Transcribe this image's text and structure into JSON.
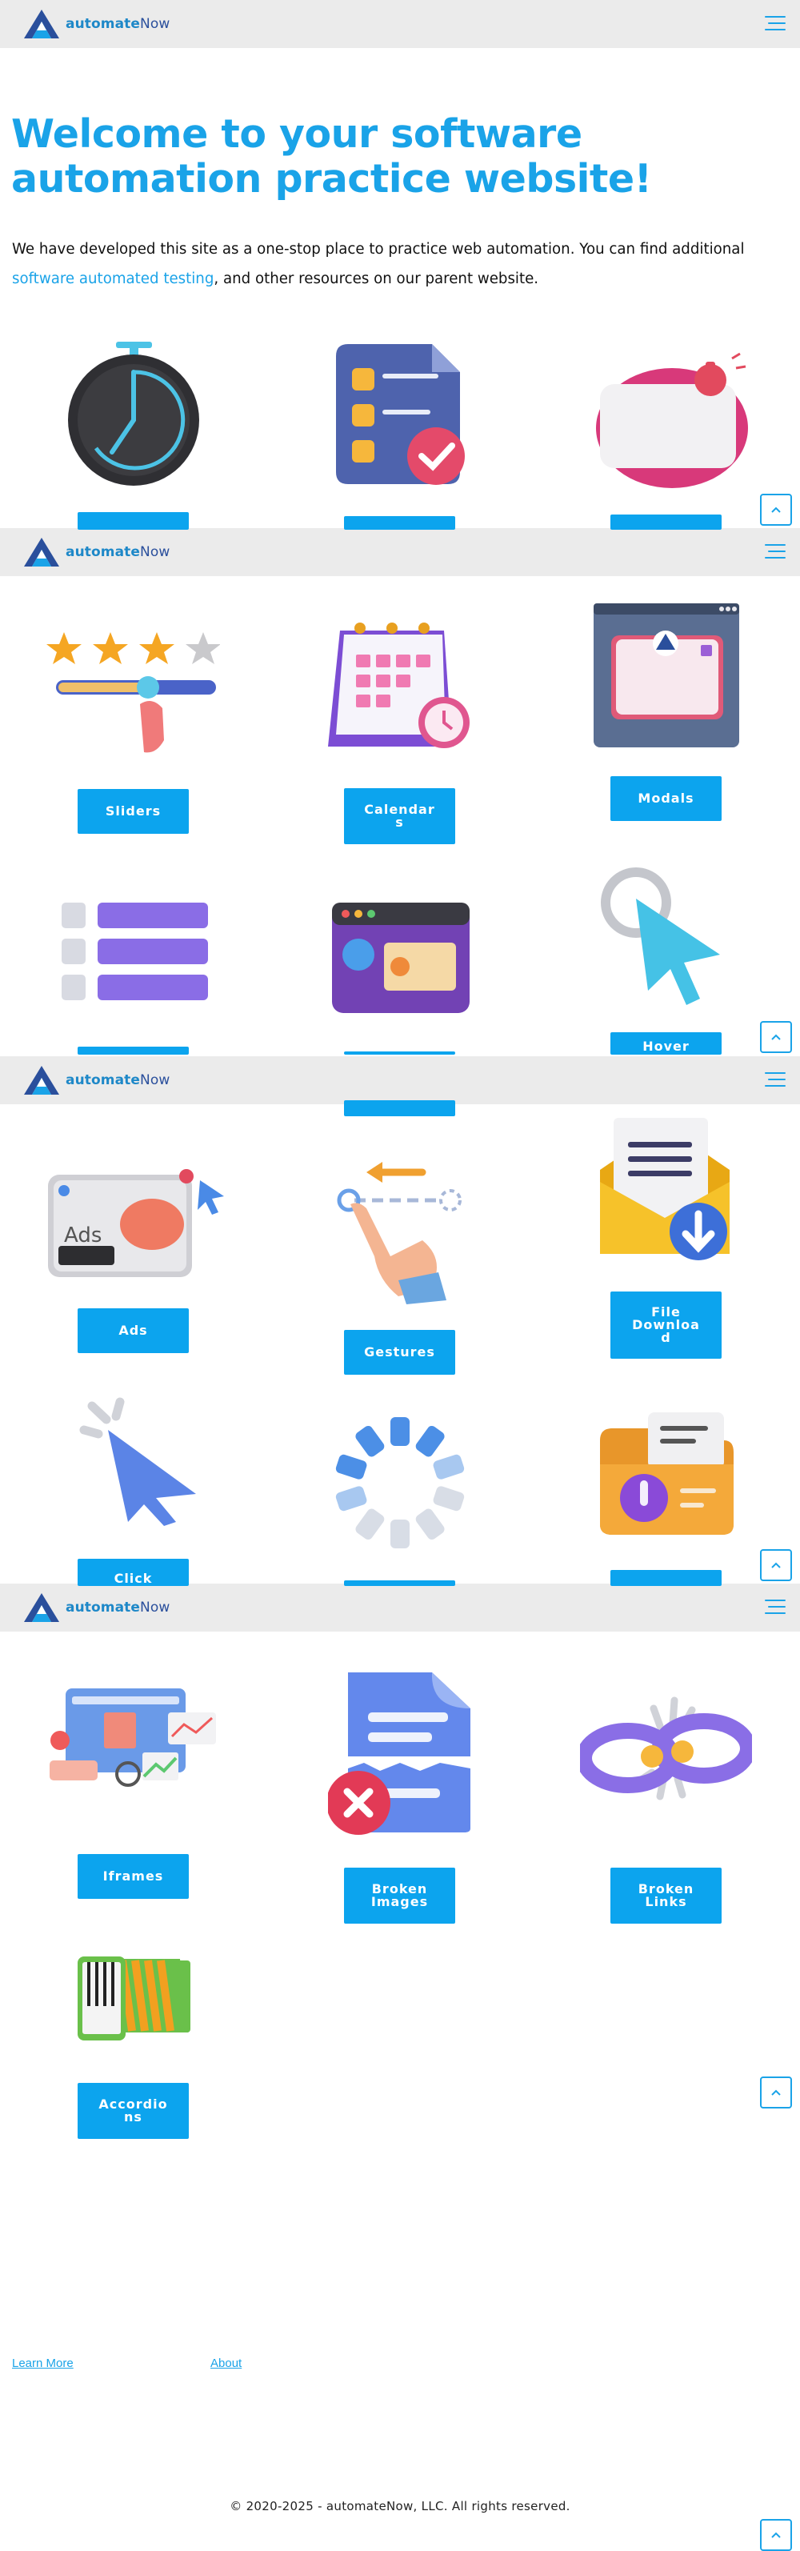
{
  "header": {
    "logo_bold": "automate",
    "logo_light": "Now"
  },
  "hero": {
    "title": "Welcome to your software automation practice website!",
    "intro_before": "We have developed this site as a one-stop place to practice web automation. You can find additional",
    "intro_link": "software automated testing",
    "intro_after": ", and other resources on our parent website."
  },
  "tiles": {
    "sliders": "Sliders",
    "calendars": "Calendar\ns",
    "modals": "Modals",
    "hover": "Hover",
    "ads": "Ads",
    "gestures": "Gestures",
    "file_download": "File\nDownloa\nd",
    "click": "Click",
    "iframes": "Iframes",
    "broken_images": "Broken\nImages",
    "broken_links": "Broken\nLinks",
    "accordions": "Accordio\nns"
  },
  "footer": {
    "learn_more": "Learn More",
    "about": "About",
    "copyright": "© 2020-2025 - automateNow, LLC. All rights reserved."
  },
  "colors": {
    "accent": "#1aa3e8",
    "button": "#0ca4ee",
    "header_bg": "#ebebeb"
  },
  "icons": [
    "logo-icon",
    "menu-icon",
    "back-to-top-icon"
  ]
}
